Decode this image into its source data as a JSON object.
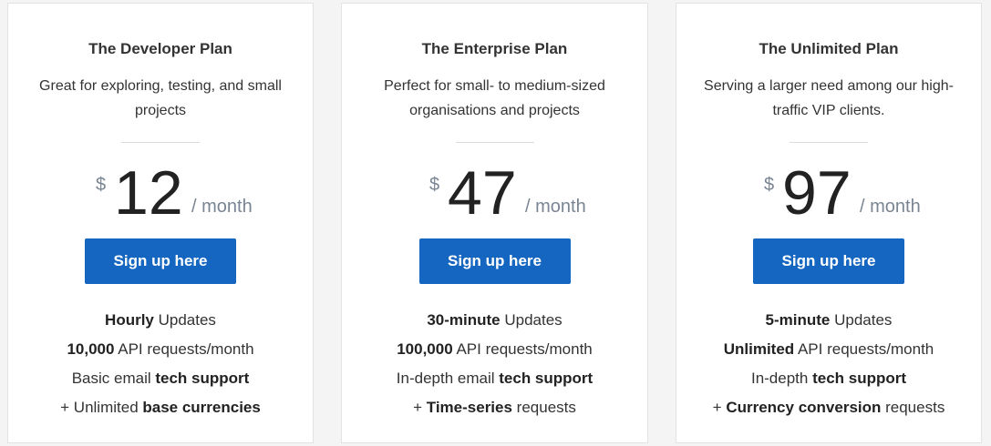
{
  "colors": {
    "background": "#f4f4f4",
    "card": "#ffffff",
    "button": "#1466c0",
    "button_text": "#ffffff",
    "muted": "#7a8593"
  },
  "plans": [
    {
      "title": "The Developer Plan",
      "description": "Great for exploring, testing, and small projects",
      "currency": "$",
      "price": "12",
      "period": "/ month",
      "cta": "Sign up here",
      "features": [
        {
          "pre": "",
          "bold": "Hourly",
          "post": " Updates"
        },
        {
          "pre": "",
          "bold": "10,000",
          "post": " API requests/month"
        },
        {
          "pre": "Basic email ",
          "bold": "tech support",
          "post": ""
        },
        {
          "pre": "+ Unlimited ",
          "bold": "base currencies",
          "post": ""
        }
      ]
    },
    {
      "title": "The Enterprise Plan",
      "description": "Perfect for small- to medium-sized organisations and projects",
      "currency": "$",
      "price": "47",
      "period": "/ month",
      "cta": "Sign up here",
      "features": [
        {
          "pre": "",
          "bold": "30-minute",
          "post": " Updates"
        },
        {
          "pre": "",
          "bold": "100,000",
          "post": " API requests/month"
        },
        {
          "pre": "In-depth email ",
          "bold": "tech support",
          "post": ""
        },
        {
          "pre": "+ ",
          "bold": "Time-series",
          "post": " requests"
        }
      ]
    },
    {
      "title": "The Unlimited Plan",
      "description": "Serving a larger need among our high-traffic VIP clients.",
      "currency": "$",
      "price": "97",
      "period": "/ month",
      "cta": "Sign up here",
      "features": [
        {
          "pre": "",
          "bold": "5-minute",
          "post": " Updates"
        },
        {
          "pre": "",
          "bold": "Unlimited",
          "post": " API requests/month"
        },
        {
          "pre": "In-depth ",
          "bold": "tech support",
          "post": ""
        },
        {
          "pre": "+ ",
          "bold": "Currency conversion",
          "post": " requests"
        }
      ]
    }
  ]
}
